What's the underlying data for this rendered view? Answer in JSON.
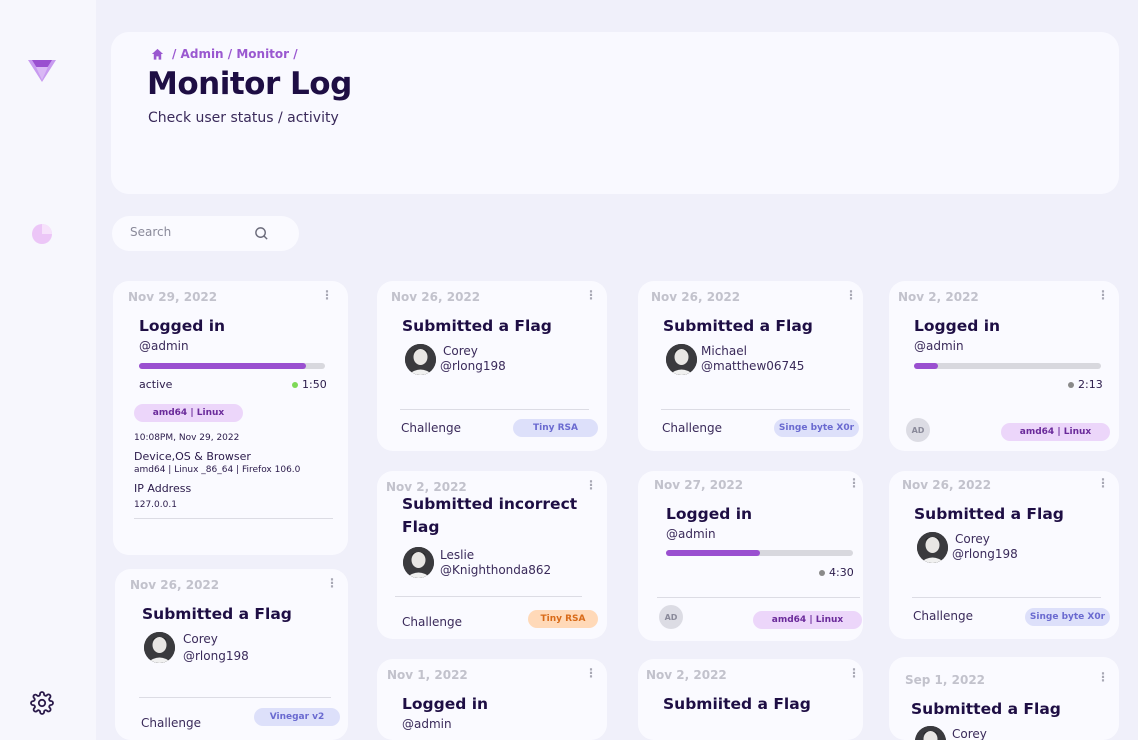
{
  "breadcrumb": {
    "path": "/ Admin / Monitor /"
  },
  "header": {
    "title": "Monitor Log",
    "subtitle": "Check user status / activity"
  },
  "search": {
    "placeholder": "Search"
  },
  "colors": {
    "accent": "#9a4fd0",
    "title": "#1e0e44",
    "background": "#f0f0fa",
    "active_dot": "#7ed957"
  },
  "icons": [
    "logo-icon",
    "pie-chart-icon",
    "gear-icon",
    "home-icon",
    "search-icon",
    "more-options-icon"
  ],
  "cards": [
    {
      "date": "Nov 29, 2022",
      "title": "Logged in",
      "handle": "@admin",
      "progress": 0.9,
      "status": "active",
      "time": "1:50",
      "tag": "amd64 | Linux",
      "timestamp": "10:08PM, Nov 29, 2022",
      "device_label": "Device,OS & Browser",
      "device_value": "amd64 | Linux _86_64 | Firefox 106.0",
      "ip_label": "IP Address",
      "ip_value": "127.0.0.1"
    },
    {
      "date": "Nov 26, 2022",
      "title": "Submitted a Flag",
      "name": "Corey",
      "handle": "@rlong198",
      "challenge_label": "Challenge",
      "tag": "Vinegar v2"
    },
    {
      "date": "Nov 26, 2022",
      "title": "Submitted a Flag",
      "name": "Corey",
      "handle": "@rlong198",
      "challenge_label": "Challenge",
      "tag": "Tiny RSA"
    },
    {
      "date": "Nov 2, 2022",
      "title": "Submitted incorrect Flag",
      "name": "Leslie",
      "handle": "@Knighthonda862",
      "challenge_label": "Challenge",
      "tag": "Tiny RSA"
    },
    {
      "date": "Nov 1, 2022",
      "title": "Logged in",
      "handle": "@admin"
    },
    {
      "date": "Nov 26, 2022",
      "title": "Submitted a Flag",
      "name": "Michael",
      "handle": "@matthew06745",
      "challenge_label": "Challenge",
      "tag": "Singe byte X0r"
    },
    {
      "date": "Nov 27, 2022",
      "title": "Logged in",
      "handle": "@admin",
      "progress": 0.5,
      "time": "4:30",
      "avatar": "AD",
      "tag": "amd64 | Linux"
    },
    {
      "date": "Nov 2, 2022",
      "title": "Submiited a Flag"
    },
    {
      "date": "Nov 2, 2022",
      "title": "Logged in",
      "handle": "@admin",
      "progress": 0.13,
      "time": "2:13",
      "avatar": "AD",
      "tag": "amd64 | Linux"
    },
    {
      "date": "Nov 26, 2022",
      "title": "Submitted a Flag",
      "name": "Corey",
      "handle": "@rlong198",
      "challenge_label": "Challenge",
      "tag": "Singe byte X0r"
    },
    {
      "date": "Sep 1, 2022",
      "title": "Submitted a Flag",
      "name": "Corey"
    }
  ],
  "menu_glyph": "⋮"
}
